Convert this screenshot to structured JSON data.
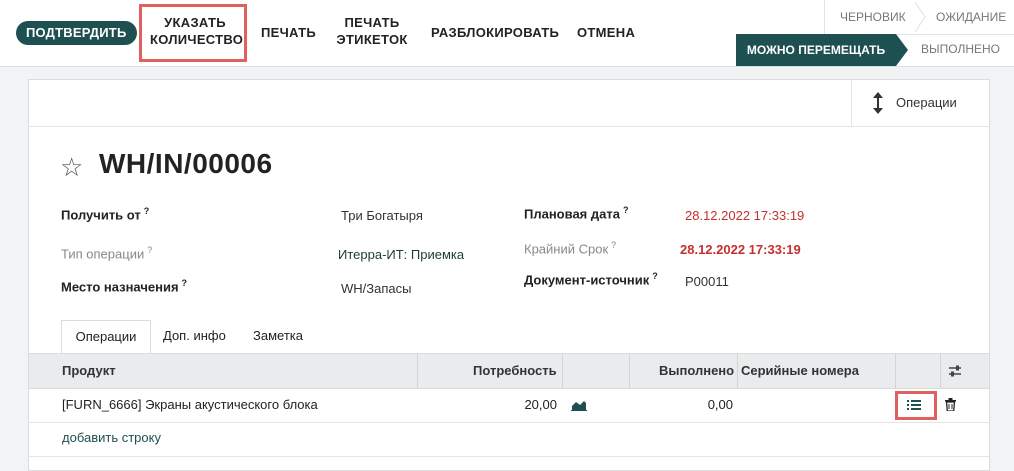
{
  "toolbar": {
    "confirm": "ПОДТВЕРДИТЬ",
    "set_qty_line1": "УКАЗАТЬ",
    "set_qty_line2": "КОЛИЧЕСТВО",
    "print": "ПЕЧАТЬ",
    "print_labels_line1": "ПЕЧАТЬ",
    "print_labels_line2": "ЭТИКЕТОК",
    "unlock": "РАЗБЛОКИРОВАТЬ",
    "cancel": "ОТМЕНА"
  },
  "statusbar": {
    "draft": "ЧЕРНОВИК",
    "waiting": "ОЖИДАНИЕ",
    "ready": "МОЖНО ПЕРЕМЕЩАТЬ",
    "done": "ВЫПОЛНЕНО",
    "active": "ready"
  },
  "sheet": {
    "ops_button": "Операции",
    "title": "WH/IN/00006",
    "fields": {
      "receive_from_label": "Получить от",
      "receive_from_value": "Три Богатыря",
      "op_type_label": "Тип операции",
      "op_type_value": "Итерра-ИТ: Приемка",
      "destination_label": "Место назначения",
      "destination_value": "WH/Запасы",
      "scheduled_label": "Плановая дата",
      "scheduled_value": "28.12.2022 17:33:19",
      "deadline_label": "Крайний Срок",
      "deadline_value": "28.12.2022 17:33:19",
      "source_label": "Документ-источник",
      "source_value": "P00011",
      "help_mark": "?"
    },
    "tabs": [
      "Операции",
      "Доп. инфо",
      "Заметка"
    ],
    "table": {
      "headers": {
        "product": "Продукт",
        "demand": "Потребность",
        "done": "Выполнено",
        "serials": "Серийные номера"
      },
      "rows": [
        {
          "product": "[FURN_6666] Экраны акустического блока",
          "demand": "20,00",
          "done": "0,00",
          "serials": ""
        }
      ],
      "add_line": "добавить строку"
    }
  },
  "colors": {
    "accent": "#1e5052",
    "date_red": "#c43030",
    "highlight": "#e05f5f"
  },
  "icons": [
    "star-icon",
    "sort-arrows-icon",
    "forecast-chart-icon",
    "detailed-operations-list-icon",
    "trash-icon",
    "optional-columns-icon"
  ]
}
